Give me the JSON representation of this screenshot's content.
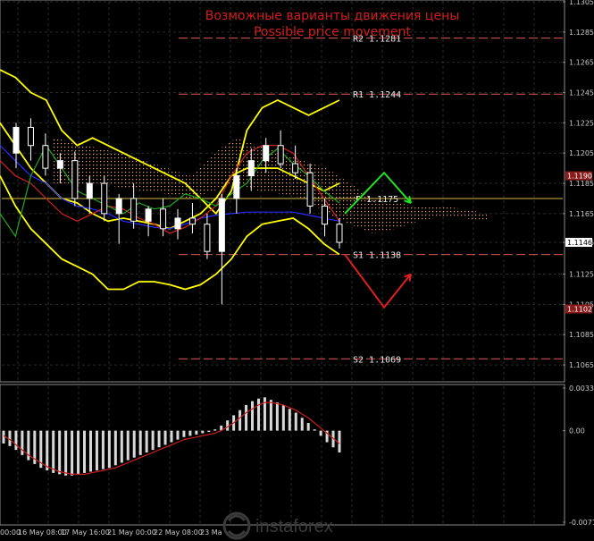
{
  "title_ru": "Возможные варианты движения цены",
  "title_en": "Possible price movement",
  "watermark": "instaforex",
  "chart_data": [
    {
      "type": "line",
      "panel": "price",
      "ylim": [
        1.1055,
        1.1305
      ],
      "y_ticks": [
        "1.1305",
        "1.1285",
        "1.1265",
        "1.1245",
        "1.1225",
        "1.1205",
        "1.1185",
        "1.1165",
        "1.1146",
        "1.1125",
        "1.1105",
        "1.1085",
        "1.1065"
      ],
      "x_ticks": [
        "00:00",
        "16 May 08:00",
        "17 May 16:00",
        "21 May 00:00",
        "22 May 08:00",
        "23 Ma"
      ],
      "levels": [
        {
          "label": "R2 1.1281",
          "value": 1.1281,
          "color": "#e05a5a",
          "style": "dashed"
        },
        {
          "label": "R1 1.1244",
          "value": 1.1244,
          "color": "#e05a5a",
          "style": "dashed"
        },
        {
          "label": "P 1.1175",
          "value": 1.1175,
          "color": "#d4b84a",
          "style": "solid"
        },
        {
          "label": "S1 1.1138",
          "value": 1.1138,
          "color": "#e05a5a",
          "style": "dashed"
        },
        {
          "label": "S2 1.1069",
          "value": 1.1069,
          "color": "#e05a5a",
          "style": "dashed"
        }
      ],
      "price_markers": [
        {
          "label": "1.1190",
          "value": 1.119,
          "color": "#8a1c1c"
        },
        {
          "label": "1.1146",
          "value": 1.1146,
          "color": "#ffffff"
        },
        {
          "label": "1.1102",
          "value": 1.1102,
          "color": "#8a1c1c"
        }
      ],
      "series": [
        {
          "color": "#ffff00",
          "values": [
            1.126,
            1.1255,
            1.1245,
            1.124,
            1.122,
            1.121,
            1.1215,
            1.121,
            1.1205,
            1.12,
            1.1195,
            1.119,
            1.1185,
            1.1175,
            1.1165,
            1.118,
            1.122,
            1.1235,
            1.124,
            1.1235,
            1.123,
            1.1235,
            1.124
          ]
        },
        {
          "color": "#ffff00",
          "values": [
            1.1225,
            1.121,
            1.1195,
            1.1185,
            1.1175,
            1.1172,
            1.1165,
            1.116,
            1.1162,
            1.116,
            1.1158,
            1.1155,
            1.116,
            1.1165,
            1.1175,
            1.119,
            1.1195,
            1.1195,
            1.1195,
            1.119,
            1.1185,
            1.118,
            1.1185
          ]
        },
        {
          "color": "#ffff00",
          "values": [
            1.119,
            1.117,
            1.1155,
            1.1145,
            1.1135,
            1.113,
            1.1125,
            1.1115,
            1.1115,
            1.112,
            1.112,
            1.1118,
            1.1115,
            1.1118,
            1.1125,
            1.1135,
            1.115,
            1.1158,
            1.116,
            1.1162,
            1.1155,
            1.1145,
            1.1138
          ]
        },
        {
          "color": "#2a2aff",
          "values": [
            1.121,
            1.12,
            1.119,
            1.1185,
            1.1175,
            1.117,
            1.1168,
            1.1165,
            1.116,
            1.1158,
            1.1156,
            1.1155,
            1.1158,
            1.1162,
            1.1164,
            1.1165,
            1.1166,
            1.1166,
            1.1166,
            1.1166,
            1.1164,
            1.1162,
            1.116
          ]
        },
        {
          "color": "#d22020",
          "values": [
            1.12,
            1.119,
            1.1185,
            1.1175,
            1.1165,
            1.116,
            1.1165,
            1.117,
            1.1168,
            1.1162,
            1.1158,
            1.1152,
            1.1156,
            1.1162,
            1.117,
            1.119,
            1.1205,
            1.121,
            1.121,
            1.1205,
            1.119,
            1.1175,
            1.116
          ]
        },
        {
          "color": "#1fa81f",
          "values": [
            1.1165,
            1.115,
            1.119,
            1.121,
            1.1195,
            1.118,
            1.1175,
            1.117,
            1.1165,
            1.1172,
            1.1168,
            1.117,
            1.1178,
            1.1175,
            1.117,
            1.1178,
            1.1185,
            1.12,
            1.1208,
            1.1198,
            1.119,
            1.118,
            1.1172
          ]
        }
      ],
      "ichimoku_cloud": {
        "upper": [
          1.1215,
          1.1212,
          1.1208,
          1.1205,
          1.12,
          1.1195,
          1.119,
          1.1205,
          1.1215,
          1.121,
          1.1205,
          1.12,
          1.1195,
          1.1185,
          1.1175,
          1.1172,
          1.117,
          1.117,
          1.1168,
          1.1165
        ],
        "lower": [
          1.1185,
          1.1185,
          1.1185,
          1.1182,
          1.118,
          1.1178,
          1.1175,
          1.118,
          1.1185,
          1.118,
          1.1178,
          1.1175,
          1.1165,
          1.1158,
          1.1152,
          1.1155,
          1.116,
          1.1163,
          1.1162,
          1.116
        ]
      },
      "candles": [
        {
          "o": 1.1205,
          "h": 1.1225,
          "l": 1.1195,
          "c": 1.1222
        },
        {
          "o": 1.1222,
          "h": 1.1228,
          "l": 1.12,
          "c": 1.121
        },
        {
          "o": 1.121,
          "h": 1.1218,
          "l": 1.119,
          "c": 1.1195
        },
        {
          "o": 1.1195,
          "h": 1.1205,
          "l": 1.1185,
          "c": 1.12
        },
        {
          "o": 1.12,
          "h": 1.1206,
          "l": 1.117,
          "c": 1.1175
        },
        {
          "o": 1.1175,
          "h": 1.119,
          "l": 1.1165,
          "c": 1.1185
        },
        {
          "o": 1.1185,
          "h": 1.119,
          "l": 1.116,
          "c": 1.1165
        },
        {
          "o": 1.1165,
          "h": 1.1178,
          "l": 1.1145,
          "c": 1.1175
        },
        {
          "o": 1.1175,
          "h": 1.1185,
          "l": 1.1155,
          "c": 1.116
        },
        {
          "o": 1.116,
          "h": 1.117,
          "l": 1.115,
          "c": 1.1168
        },
        {
          "o": 1.1168,
          "h": 1.1175,
          "l": 1.115,
          "c": 1.1155
        },
        {
          "o": 1.1155,
          "h": 1.1168,
          "l": 1.1148,
          "c": 1.1162
        },
        {
          "o": 1.1162,
          "h": 1.1172,
          "l": 1.1152,
          "c": 1.1158
        },
        {
          "o": 1.1158,
          "h": 1.1165,
          "l": 1.1135,
          "c": 1.114
        },
        {
          "o": 1.114,
          "h": 1.1178,
          "l": 1.1105,
          "c": 1.1175
        },
        {
          "o": 1.1175,
          "h": 1.1195,
          "l": 1.1165,
          "c": 1.119
        },
        {
          "o": 1.119,
          "h": 1.1208,
          "l": 1.118,
          "c": 1.12
        },
        {
          "o": 1.12,
          "h": 1.1215,
          "l": 1.1192,
          "c": 1.121
        },
        {
          "o": 1.121,
          "h": 1.122,
          "l": 1.1195,
          "c": 1.1198
        },
        {
          "o": 1.1198,
          "h": 1.121,
          "l": 1.1188,
          "c": 1.1192
        },
        {
          "o": 1.1192,
          "h": 1.1198,
          "l": 1.1165,
          "c": 1.117
        },
        {
          "o": 1.117,
          "h": 1.1175,
          "l": 1.115,
          "c": 1.1158
        },
        {
          "o": 1.1158,
          "h": 1.1162,
          "l": 1.1142,
          "c": 1.1146
        }
      ],
      "arrows": [
        {
          "color": "#22e022",
          "points": [
            [
              0,
              1.1165
            ],
            [
              1,
              1.1192
            ],
            [
              2,
              1.1172
            ]
          ]
        },
        {
          "color": "#e02020",
          "points": [
            [
              0,
              1.1138
            ],
            [
              1,
              1.1103
            ],
            [
              2,
              1.1125
            ]
          ]
        }
      ]
    },
    {
      "type": "bar",
      "panel": "macd",
      "ylim": [
        -0.00714,
        0.00332
      ],
      "y_ticks": [
        "0.00332",
        "0.00",
        "-0.00714"
      ],
      "values": [
        -0.001,
        -0.0012,
        -0.0015,
        -0.0019,
        -0.0023,
        -0.0026,
        -0.0029,
        -0.0031,
        -0.0033,
        -0.0034,
        -0.0035,
        -0.0035,
        -0.0034,
        -0.0033,
        -0.0032,
        -0.0031,
        -0.003,
        -0.0029,
        -0.0027,
        -0.0025,
        -0.0023,
        -0.0021,
        -0.0019,
        -0.0017,
        -0.0015,
        -0.0013,
        -0.0011,
        -0.0009,
        -0.0007,
        -0.0005,
        -0.0004,
        -0.0003,
        -0.0002,
        -0.0001,
        0.0001,
        0.0004,
        0.0008,
        0.0012,
        0.0016,
        0.002,
        0.0023,
        0.0025,
        0.0026,
        0.0024,
        0.0022,
        0.002,
        0.0017,
        0.0014,
        0.001,
        0.0006,
        0.0001,
        -0.0004,
        -0.0009,
        -0.0013,
        -0.0017
      ],
      "signal": [
        -0.0004,
        -0.0007,
        -0.0011,
        -0.0015,
        -0.0019,
        -0.0022,
        -0.0025,
        -0.0028,
        -0.003,
        -0.0032,
        -0.0033,
        -0.0034,
        -0.0034,
        -0.0034,
        -0.0033,
        -0.0032,
        -0.0031,
        -0.003,
        -0.0029,
        -0.0027,
        -0.0025,
        -0.0023,
        -0.0021,
        -0.0019,
        -0.0017,
        -0.0015,
        -0.0013,
        -0.0011,
        -0.0009,
        -0.0007,
        -0.0006,
        -0.0005,
        -0.0004,
        -0.0003,
        -0.0002,
        -0.0,
        0.0003,
        0.0006,
        0.001,
        0.0014,
        0.0017,
        0.002,
        0.0022,
        0.0022,
        0.0021,
        0.002,
        0.0018,
        0.0016,
        0.0013,
        0.001,
        0.0006,
        0.0002,
        -0.0002,
        -0.0006,
        -0.001
      ],
      "signal_color": "#c81e1e"
    }
  ]
}
